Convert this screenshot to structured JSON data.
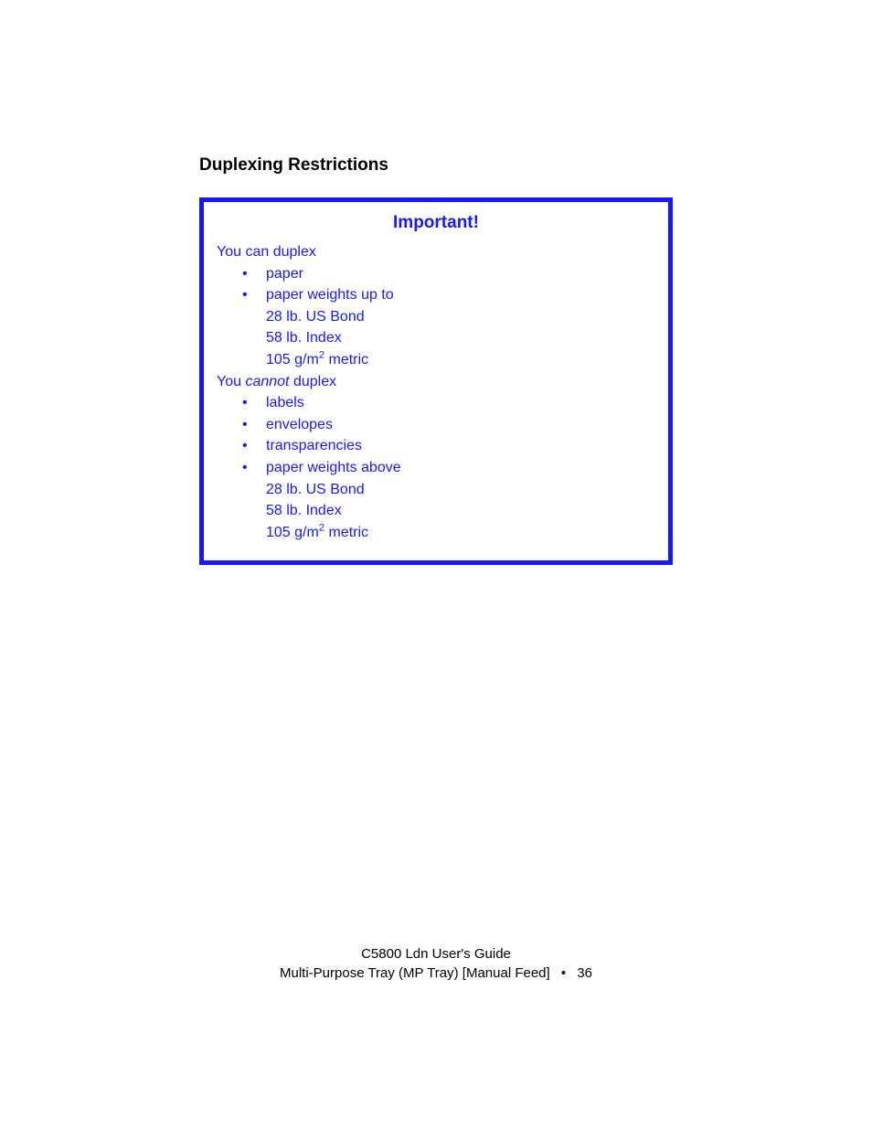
{
  "heading": "Duplexing Restrictions",
  "box": {
    "title": "Important!",
    "can": {
      "intro_prefix": "You can duplex",
      "items": [
        {
          "text": "paper"
        },
        {
          "text": "paper weights up to",
          "sub": [
            "28 lb. US Bond",
            "58 lb. Index",
            "105 g/m² metric"
          ],
          "sub_has_sup": true
        }
      ]
    },
    "cannot": {
      "intro_prefix": "You ",
      "intro_italic": "cannot",
      "intro_suffix": " duplex",
      "items": [
        {
          "text": "labels"
        },
        {
          "text": "envelopes"
        },
        {
          "text": "transparencies"
        },
        {
          "text": "paper weights above",
          "sub": [
            "28 lb. US Bond",
            "58 lb. Index",
            "105 g/m² metric"
          ],
          "sub_has_sup": true
        }
      ]
    }
  },
  "footer": {
    "line1": "C5800 Ldn User's Guide",
    "line2_left": "Multi-Purpose Tray (MP Tray) [Manual Feed]",
    "bullet": "•",
    "page_number": "36"
  }
}
